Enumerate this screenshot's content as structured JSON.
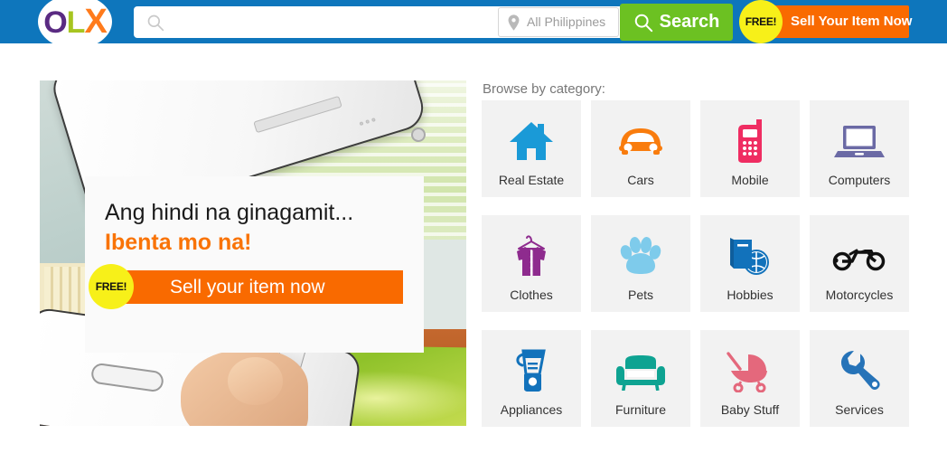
{
  "header": {
    "logo": {
      "part1": "O",
      "part2": "L",
      "part3": "X",
      "name": "OLX"
    },
    "search": {
      "value": "",
      "placeholder": "",
      "icon": "search-icon"
    },
    "location": {
      "value": "All Philippines",
      "icon": "location-pin-icon"
    },
    "search_button": {
      "label": "Search",
      "icon": "search-icon"
    },
    "sell_button": {
      "badge": "FREE!",
      "label": "Sell Your Item Now"
    },
    "colors": {
      "bar": "#0e76bc",
      "search_green": "#6cc122",
      "sell_orange": "#f96a00",
      "badge_yellow": "#f7f019"
    }
  },
  "hero": {
    "headline": "Ang hindi na ginagamit...",
    "subheadline": "Ibenta mo na!",
    "cta": {
      "badge": "FREE!",
      "label": "Sell your item now"
    }
  },
  "categories": {
    "title": "Browse by category:",
    "items": [
      {
        "label": "Real Estate",
        "icon": "house-icon",
        "color": "#1a9ad7"
      },
      {
        "label": "Cars",
        "icon": "car-icon",
        "color": "#f97c0d"
      },
      {
        "label": "Mobile",
        "icon": "mobile-phone-icon",
        "color": "#ef2d62"
      },
      {
        "label": "Computers",
        "icon": "laptop-icon",
        "color": "#6b6aa5"
      },
      {
        "label": "Clothes",
        "icon": "shirt-hanger-icon",
        "color": "#8e2b8e"
      },
      {
        "label": "Pets",
        "icon": "paw-print-icon",
        "color": "#7ecbeb"
      },
      {
        "label": "Hobbies",
        "icon": "book-ball-icon",
        "color": "#1272bb"
      },
      {
        "label": "Motorcycles",
        "icon": "motorcycle-icon",
        "color": "#111111"
      },
      {
        "label": "Appliances",
        "icon": "blender-icon",
        "color": "#1272bb"
      },
      {
        "label": "Furniture",
        "icon": "armchair-icon",
        "color": "#0ea392"
      },
      {
        "label": "Baby Stuff",
        "icon": "stroller-icon",
        "color": "#e4687c"
      },
      {
        "label": "Services",
        "icon": "wrench-icon",
        "color": "#2673b8"
      }
    ]
  }
}
